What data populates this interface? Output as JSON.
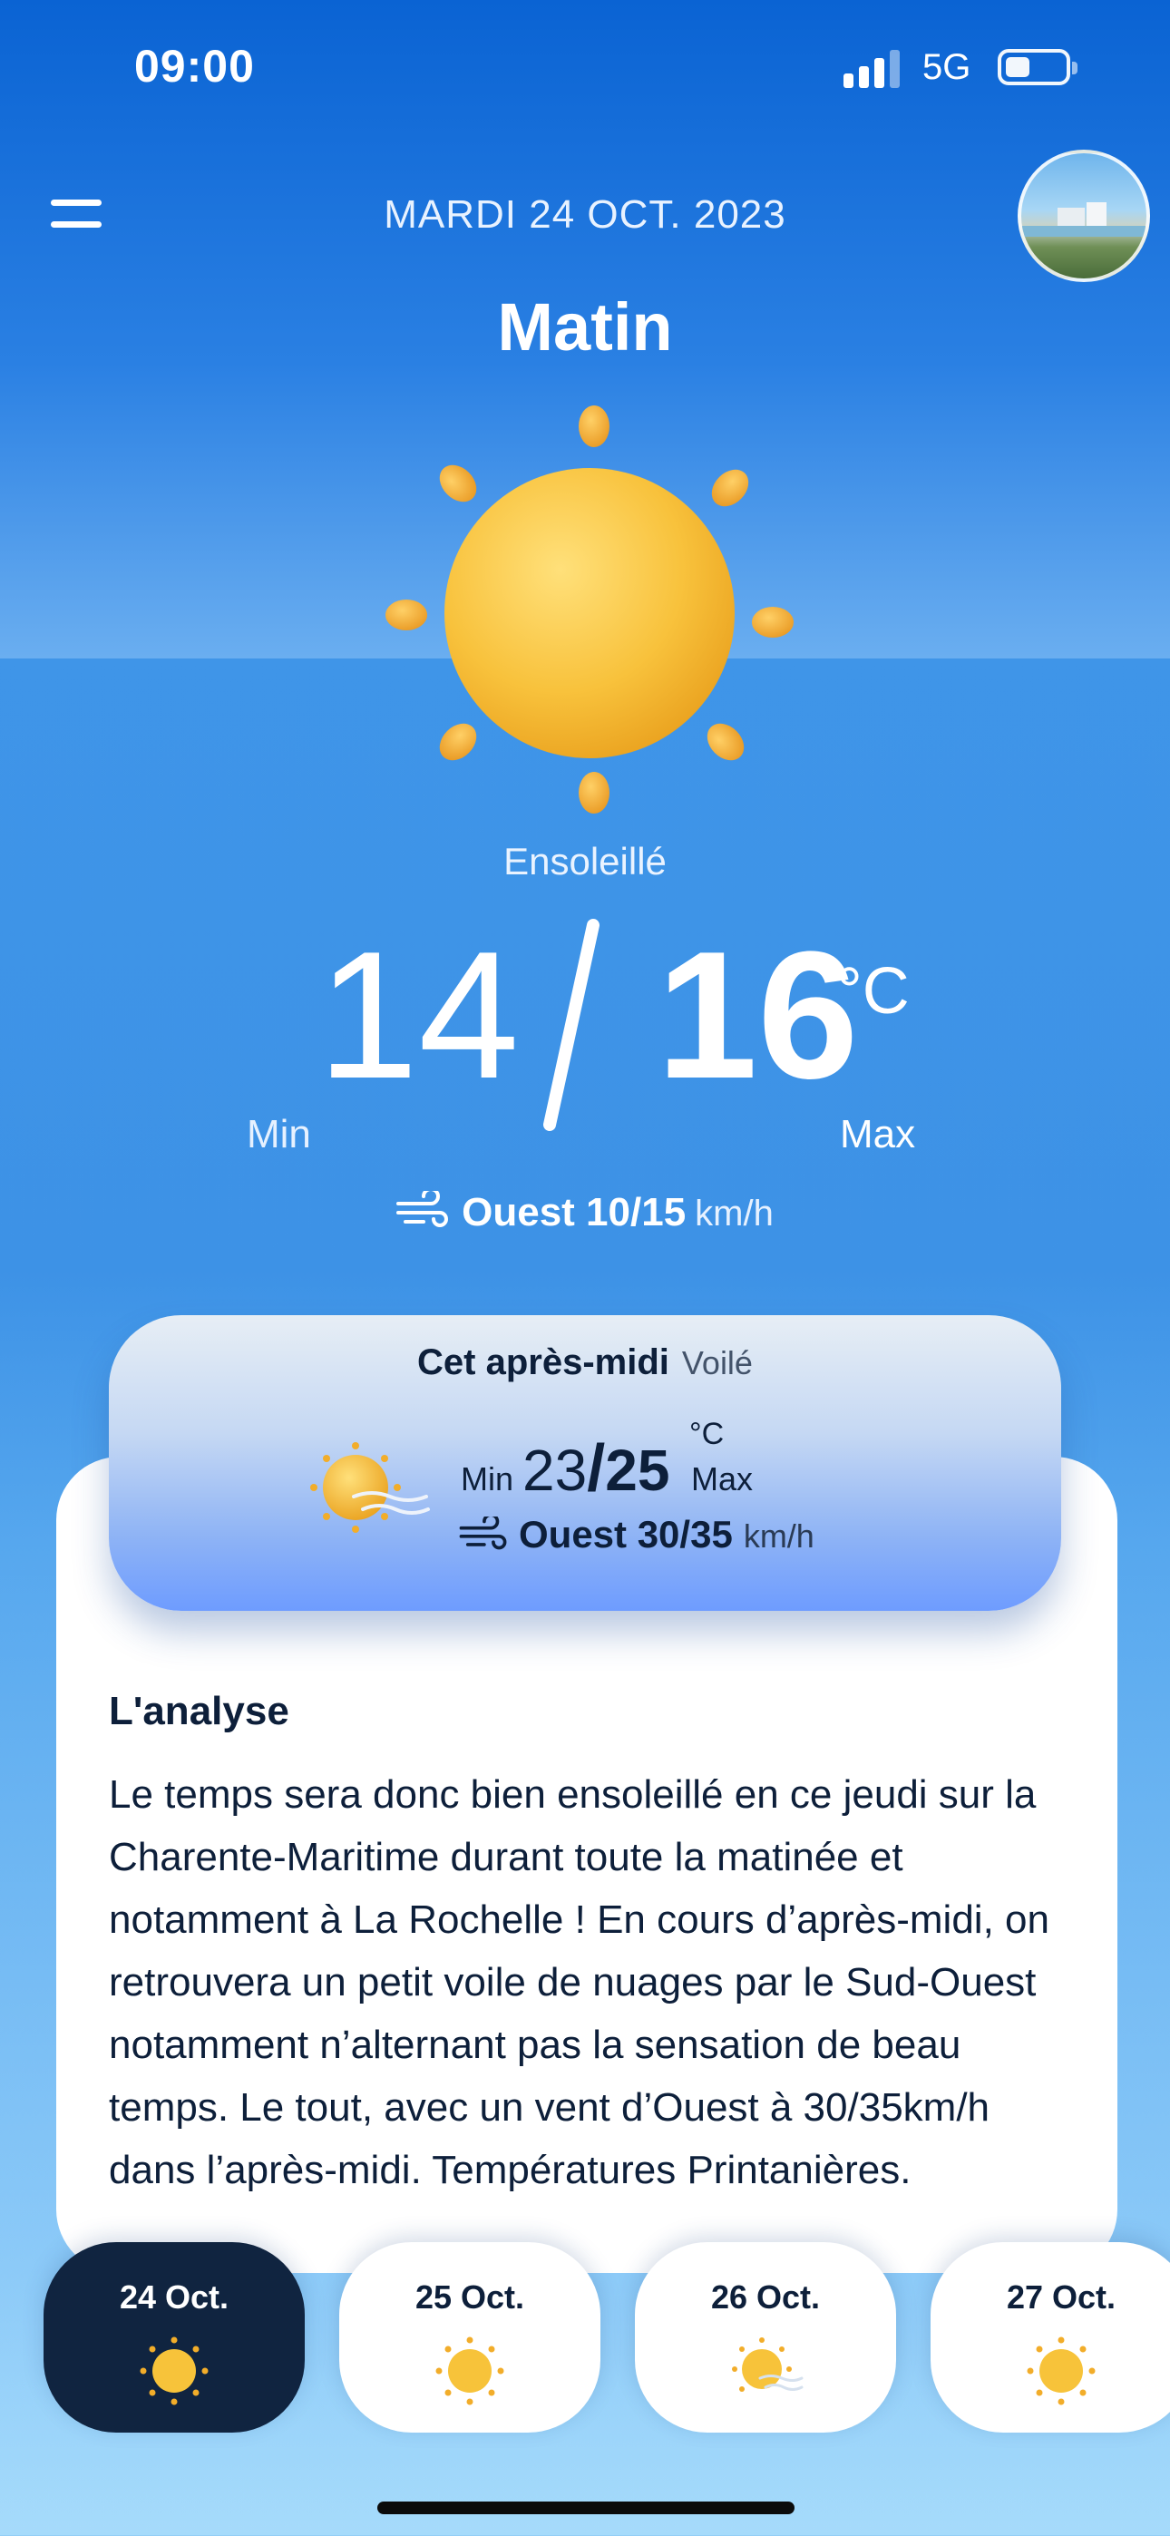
{
  "status": {
    "time": "09:00",
    "network": "5G"
  },
  "header": {
    "date": "MARDI 24 OCT. 2023",
    "period": "Matin"
  },
  "icons": {
    "menu": "menu-icon",
    "weather_main": "sun-icon",
    "wind": "wind-icon",
    "weather_pm": "sun-haze-icon"
  },
  "current": {
    "condition": "Ensoleillé",
    "min": "14",
    "max": "16",
    "unit": "°C",
    "min_label": "Min",
    "max_label": "Max",
    "wind_dir": "Ouest 10/15",
    "wind_unit": "km/h"
  },
  "afternoon": {
    "title": "Cet après-midi",
    "condition": "Voilé",
    "min_label": "Min",
    "min": "23",
    "separator": "/",
    "max": "25",
    "unit": "°C",
    "max_label": "Max",
    "wind_dir": "Ouest 30/35",
    "wind_unit": "km/h"
  },
  "analysis": {
    "title": "L'analyse",
    "text": "Le temps sera donc bien ensoleillé en ce jeudi sur la Charente-Maritime durant toute la matinée et notamment à La Rochelle ! En cours d’après-midi, on retrouvera un petit voile de nuages par le Sud-Ouest notamment n’alternant pas la sensation de beau temps. Le tout, avec un vent d’Ouest à 30/35km/h dans l’après-midi. Températures Printanières."
  },
  "days": [
    {
      "label": "24 Oct.",
      "icon": "sun-icon",
      "active": true
    },
    {
      "label": "25 Oct.",
      "icon": "sun-icon",
      "active": false
    },
    {
      "label": "26 Oct.",
      "icon": "sun-haze-icon",
      "active": false
    },
    {
      "label": "27 Oct.",
      "icon": "sun-icon",
      "active": false
    }
  ],
  "colors": {
    "accent_dark": "#102440",
    "sky_top": "#0a6ad8",
    "sun": "#f7c33a"
  }
}
